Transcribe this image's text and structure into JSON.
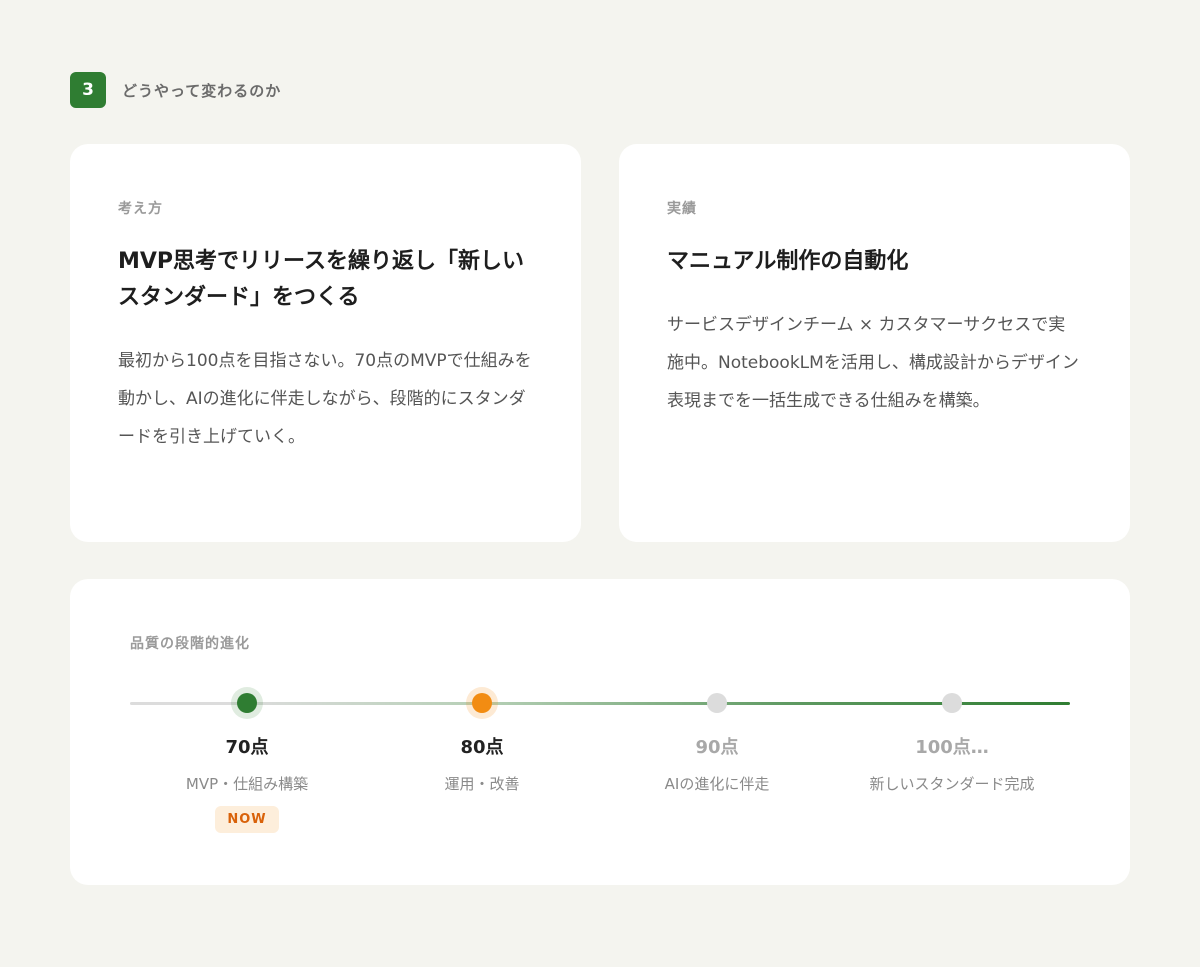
{
  "section": {
    "number": "3",
    "title": "どうやって変わるのか"
  },
  "cards": [
    {
      "label": "考え方",
      "heading": "MVP思考でリリースを繰り返し「新しいスタンダード」をつくる",
      "body": "最初から100点を目指さない。70点のMVPで仕組みを動かし、AIの進化に伴走しながら、段階的にスタンダードを引き上げていく。"
    },
    {
      "label": "実績",
      "heading": "マニュアル制作の自動化",
      "body": "サービスデザインチーム × カスタマーサクセスで実施中。NotebookLMを活用し、構成設計からデザイン表現までを一括生成できる仕組みを構築。"
    }
  ],
  "timeline": {
    "title": "品質の段階的進化",
    "milestones": [
      {
        "score": "70点",
        "desc": "MVP・仕組み構築",
        "badge": "NOW"
      },
      {
        "score": "80点",
        "desc": "運用・改善"
      },
      {
        "score": "90点",
        "desc": "AIの進化に伴走"
      },
      {
        "score": "100点…",
        "desc": "新しいスタンダード完成"
      }
    ]
  },
  "colors": {
    "accent_green": "#2f7d32",
    "accent_orange": "#f28c12",
    "badge_bg": "#fdeedb",
    "badge_text": "#d9620a",
    "inactive_dot": "#dcdcdc"
  }
}
